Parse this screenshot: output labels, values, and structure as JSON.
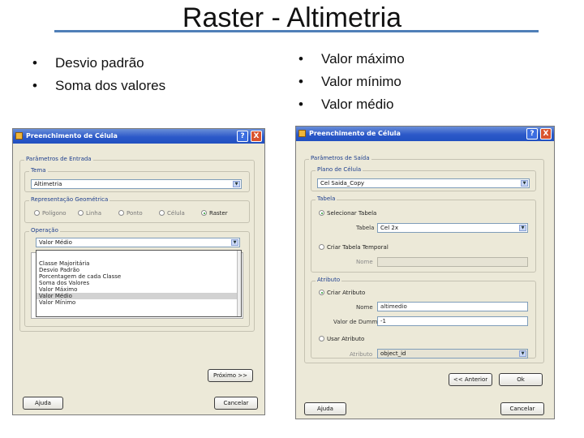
{
  "slide": {
    "title": "Raster - Altimetria",
    "bullets_left": [
      "Desvio padrão",
      "Soma dos valores"
    ],
    "bullets_right": [
      "Valor máximo",
      "Valor mínimo",
      "Valor médio"
    ],
    "accent_color": "#4f7fb8"
  },
  "dialog1": {
    "title": "Preenchimento de Célula",
    "help_label": "?",
    "close_label": "X",
    "group_params": "Parâmetros de Entrada",
    "group_tema": "Tema",
    "tema_value": "Altimetria",
    "group_rep": "Representação Geométrica",
    "rep_options": [
      "Polígono",
      "Linha",
      "Ponto",
      "Célula",
      "Raster"
    ],
    "rep_selected": "Raster",
    "group_op": "Operação",
    "op_value": "Valor Médio",
    "op_list": [
      "Classe Majoritária",
      "Desvio Padrão",
      "Porcentagem de cada Classe",
      "Soma dos Valores",
      "Valor Máximo",
      "Valor Médio",
      "Valor Mínimo"
    ],
    "op_list_selected": "Valor Médio",
    "next_button": "Próximo >>",
    "help_button": "Ajuda",
    "cancel_button": "Cancelar"
  },
  "dialog2": {
    "title": "Preenchimento de Célula",
    "help_label": "?",
    "close_label": "X",
    "group_params": "Parâmetros de Saída",
    "group_plano": "Plano de Célula",
    "plano_value": "Cel Saida_Copy",
    "group_tabela": "Tabela",
    "sel_tabela_label": "Selecionar Tabela",
    "tabela_label": "Tabela",
    "tabela_value": "Cel 2x",
    "criar_tabela_label": "Criar Tabela Temporal",
    "nome_label": "Nome",
    "nome_value": "",
    "group_atributo": "Atributo",
    "criar_atributo_label": "Criar Atributo",
    "atrib_nome_label": "Nome",
    "atrib_nome_value": "altimedio",
    "dummy_label": "Valor de Dummy",
    "dummy_value": "-1",
    "usar_atributo_label": "Usar Atributo",
    "atributo_label": "Atributo",
    "atributo_value": "object_id",
    "back_button": "<< Anterior",
    "ok_button": "Ok",
    "help_button": "Ajuda",
    "cancel_button": "Cancelar"
  }
}
